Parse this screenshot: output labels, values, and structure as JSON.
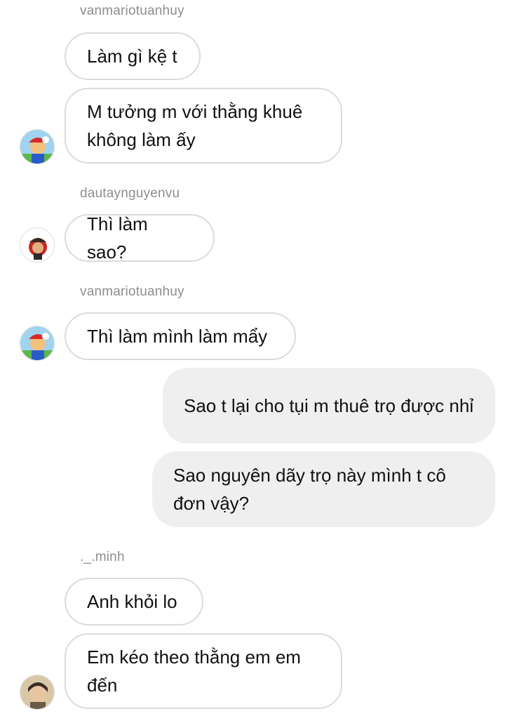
{
  "thread": {
    "senders": {
      "s1": "vanmariotuanhuy",
      "s2": "dautaynguyenvu",
      "s3": "vanmariotuanhuy",
      "s4": "._.minh"
    },
    "messages": {
      "m1": "Làm gì kệ t",
      "m2": "M tưởng m với thằng khuê không làm ấy",
      "m3": "Thì làm sao?",
      "m4": "Thì làm mình làm mẩy",
      "m5": "Sao t lại cho tụi m thuê trọ được nhỉ",
      "m6": "Sao nguyên dãy trọ này mình t cô đơn vậy?",
      "m7": "Anh khỏi lo",
      "m8": "Em kéo theo thằng em em đến"
    },
    "avatars": [
      "mario-avatar",
      "mario-avatar-dark",
      "mario-avatar",
      "person-avatar"
    ]
  }
}
